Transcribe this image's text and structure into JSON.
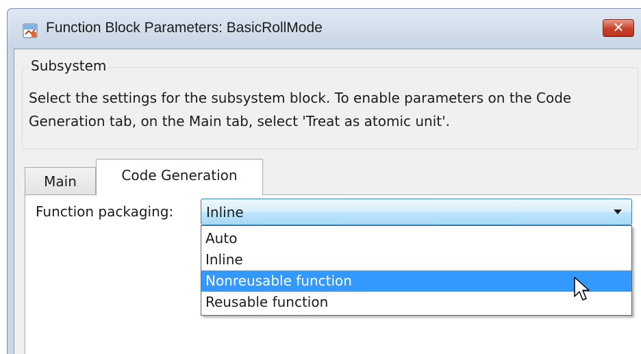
{
  "window": {
    "title": "Function Block Parameters: BasicRollMode",
    "close_glyph": "✕"
  },
  "group": {
    "label": "Subsystem",
    "description": "Select the settings for the subsystem block. To enable parameters on the Code Generation tab, on the Main tab, select 'Treat as atomic unit'."
  },
  "tabs": [
    {
      "label": "Main",
      "active": false
    },
    {
      "label": "Code Generation",
      "active": true
    }
  ],
  "function_packaging": {
    "label": "Function packaging:",
    "value": "Inline",
    "options": [
      "Auto",
      "Inline",
      "Nonreusable function",
      "Reusable function"
    ],
    "highlighted": "Nonreusable function"
  },
  "icons": {
    "app": "simulink-block-icon",
    "close": "close-icon",
    "dropdown": "chevron-down-icon",
    "cursor": "mouse-pointer-icon"
  },
  "colors": {
    "highlight": "#3399ff",
    "close_button": "#c8402a",
    "combo_border": "#3c7fb1"
  }
}
